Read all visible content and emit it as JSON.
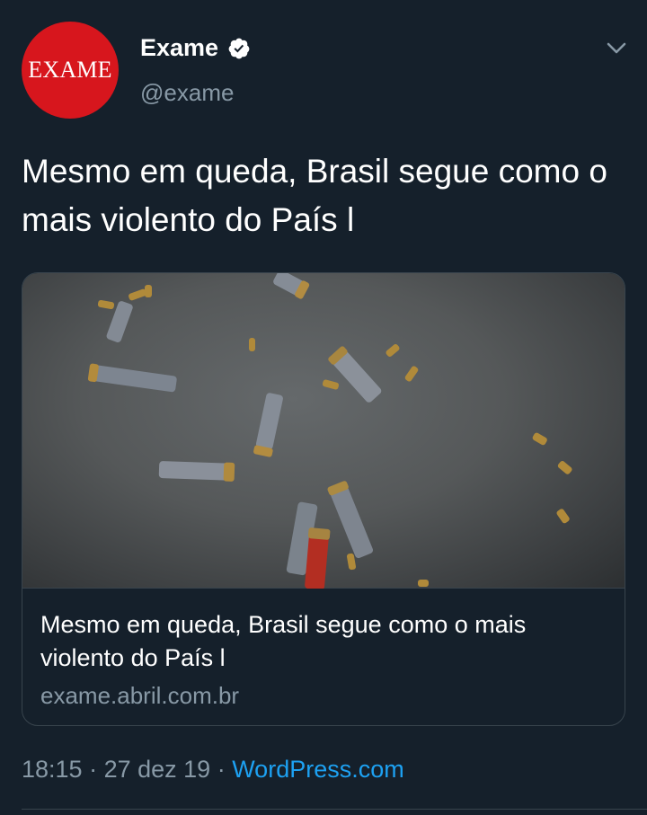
{
  "account": {
    "display_name": "Exame",
    "handle": "@exame",
    "avatar_text": "EXAME",
    "verified": true,
    "avatar_color": "#d7161d"
  },
  "tweet": {
    "text": "Mesmo em queda, Brasil segue como o mais violento do País l"
  },
  "card": {
    "title": "Mesmo em queda, Brasil segue como o mais violento do País l",
    "domain": "exame.abril.com.br",
    "image_description_icon": "shell-casings-image"
  },
  "meta": {
    "time": "18:15",
    "separator1": " · ",
    "date": "27 dez 19",
    "separator2": " · ",
    "source": "WordPress.com"
  },
  "colors": {
    "background": "#15202b",
    "secondary_text": "#8899a6",
    "link": "#1da1f2",
    "border": "#38444d"
  }
}
